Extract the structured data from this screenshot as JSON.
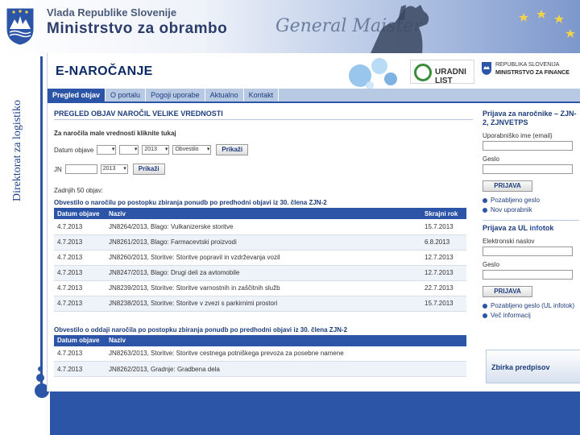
{
  "banner": {
    "gov_name": "Vlada Republike Slovenije",
    "ministry_name": "Ministrstvo za obrambo",
    "script_text": "General Maister"
  },
  "side_caption": "Direktorat za logistiko",
  "portal": {
    "title": "E-NAROČANJE",
    "uradni_list": "URADNI LIST",
    "mf_line1": "REPUBLIKA SLOVENIJA",
    "mf_line2": "MINISTRSTVO ZA FINANCE"
  },
  "nav": {
    "tabs": [
      "Pregled objav",
      "O portalu",
      "Pogoji uporabe",
      "Aktualno",
      "Kontakt"
    ]
  },
  "main": {
    "section_title": "PREGLED OBJAV NAROČIL VELIKE VREDNOSTI",
    "subsection": "Za naročila male vrednosti kliknite tukaj",
    "filter1_label": "Datum objave",
    "filter1_year": "2013",
    "filter1_type": "Obvestilo",
    "show_button": "Prikaži",
    "filter2_label": "JN",
    "filter2_year": "2013",
    "count_text": "Zadnjih 50 objav:",
    "table1_caption": "Obvestilo o naročilu po postopku zbiranja ponudb po predhodni objavi iz 30. člena ZJN-2",
    "table1_headers": [
      "Datum objave",
      "Naziv",
      "Skrajni rok"
    ],
    "table1_rows": [
      [
        "4.7.2013",
        "JN8264/2013, Blago: Vulkanizerske storitve",
        "15.7.2013"
      ],
      [
        "4.7.2013",
        "JN8261/2013, Blago: Farmacevtski proizvodi",
        "6.8.2013"
      ],
      [
        "4.7.2013",
        "JN8260/2013, Storitve: Storitve popravil in vzdrževanja vozil",
        "12.7.2013"
      ],
      [
        "4.7.2013",
        "JN8247/2013, Blago: Drugi deli za avtomobile",
        "12.7.2013"
      ],
      [
        "4.7.2013",
        "JN8239/2013, Storitve: Storitve varnostnih in zaščitnih služb",
        "22.7.2013"
      ],
      [
        "4.7.2013",
        "JN8238/2013, Storitve: Storitve v zvezi s parkirnimi prostori",
        "15.7.2013"
      ]
    ],
    "table2_caption": "Obvestilo o oddaji naročila po postopku zbiranja ponudb po predhodni objavi iz 30. člena ZJN-2",
    "table2_headers": [
      "Datum objave",
      "Naziv"
    ],
    "table2_rows": [
      [
        "4.7.2013",
        "JN8263/2013, Storitve: Storitve cestnega potniškega prevoza za posebne namene"
      ],
      [
        "4.7.2013",
        "JN8262/2013, Gradnje: Gradbena dela"
      ]
    ]
  },
  "sidebar": {
    "login_title": "Prijava za naročnike – ZJN-2, ZJNVETPS",
    "user_label": "Uporabniško ime (email)",
    "pass_label": "Geslo",
    "login_button": "PRIJAVA",
    "forgot": "Pozabljeno geslo",
    "new_user": "Nov uporabnik",
    "ul_title_prefix": "Prijava za UL",
    "ul_title_info": "info",
    "ul_title_suffix": "tok",
    "email_label": "Elektronski naslov",
    "pass2_label": "Geslo",
    "login_button2": "PRIJAVA",
    "forgot2": "Pozabljeno geslo (UL infotok)",
    "more_info": "Več informacij",
    "zbirka": "Zbirka predpisov"
  }
}
